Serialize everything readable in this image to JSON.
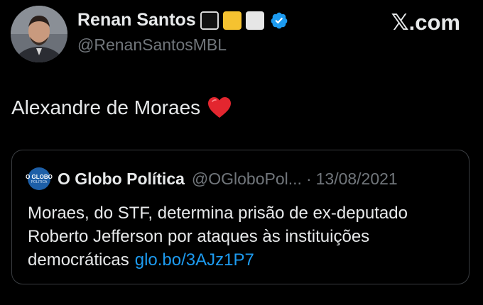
{
  "author": {
    "display_name": "Renan Santos",
    "handle": "@RenanSantosMBL",
    "verified": true,
    "badge_colors": [
      "#111111",
      "#f5c230",
      "#e6e6e6"
    ],
    "verified_color": "#1d9bf0"
  },
  "brand": {
    "label": "𝕏.com"
  },
  "tweet": {
    "text": "Alexandre de Moraes",
    "emoji": "red-heart"
  },
  "quote": {
    "avatar_title": "O GLOBO",
    "avatar_subtitle": "POLÍTICA",
    "name": "O Globo Política",
    "handle": "@OGloboPol...",
    "separator": "·",
    "date": "13/08/2021",
    "text": "Moraes, do STF, determina prisão de ex-deputado Roberto Jefferson por ataques às instituições democráticas",
    "link": "glo.bo/3AJz1P7"
  },
  "colors": {
    "background": "#000000",
    "text": "#e7e9ea",
    "muted": "#71767b",
    "link": "#1d9bf0",
    "border": "#3a3d41"
  }
}
